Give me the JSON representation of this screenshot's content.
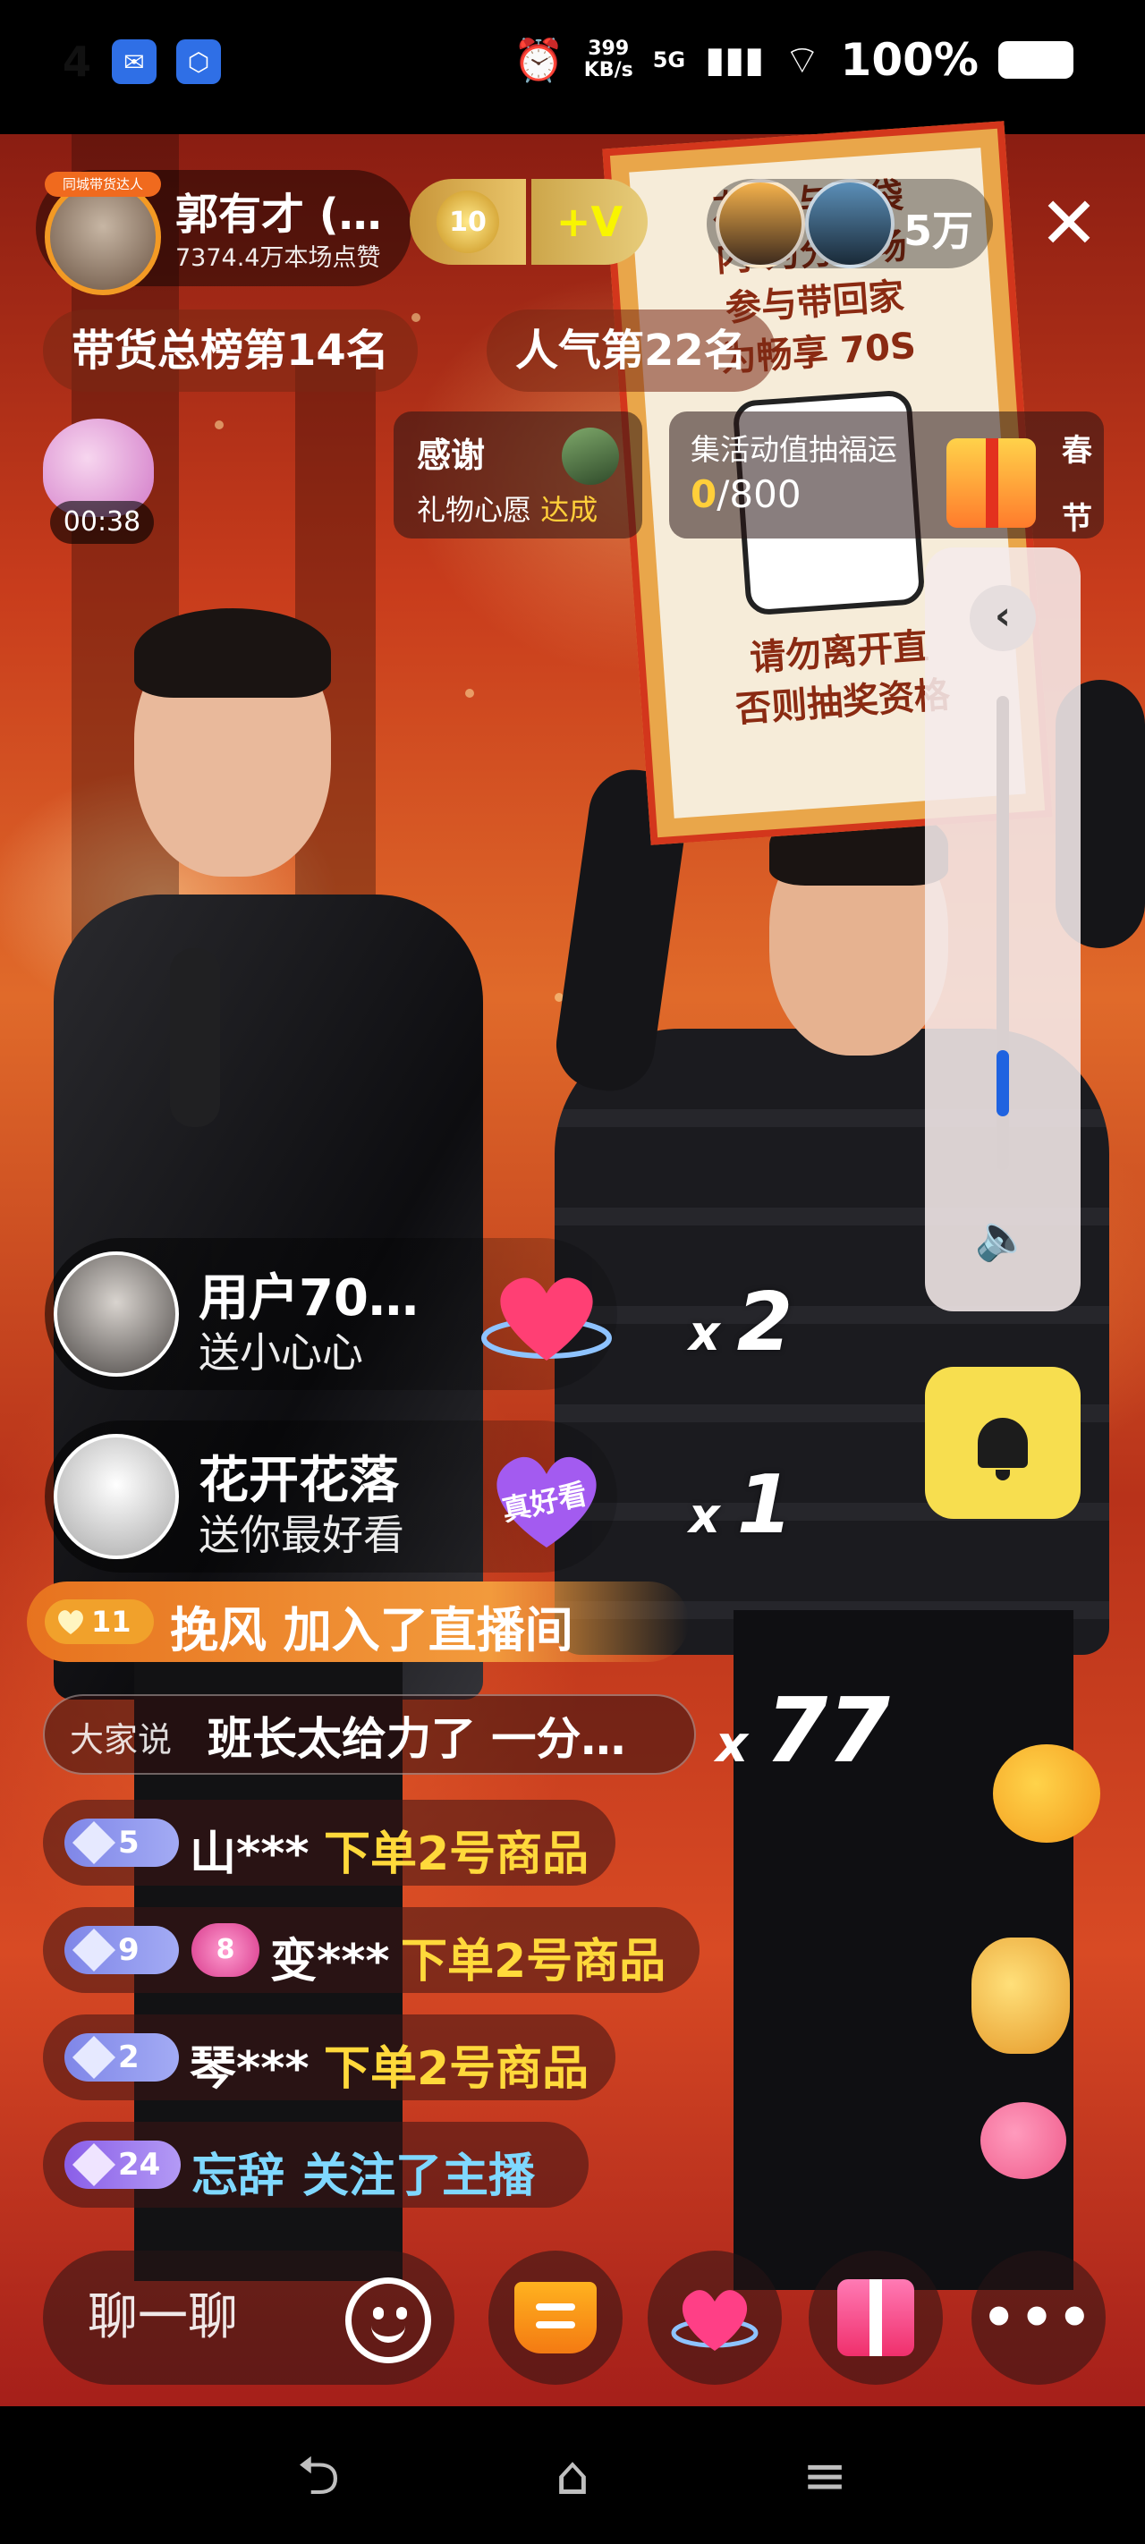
{
  "status_bar": {
    "time": "4",
    "net_speed_value": "399",
    "net_speed_unit": "KB/s",
    "signal": "5G",
    "battery": "100%"
  },
  "host": {
    "avatar_tag": "同城带货达人",
    "name": "郭有才 (…",
    "likes": "7374.4万本场点赞",
    "fan_level": "10",
    "vip_label": "+V"
  },
  "viewers": {
    "count": "5万"
  },
  "rank": {
    "sales": "带货总榜第14名",
    "popularity": "人气第22名"
  },
  "gift_bag": {
    "timer": "00:38"
  },
  "thanks_card": {
    "title": "感谢",
    "subtitle": "礼物心愿",
    "status": "达成"
  },
  "collect_card": {
    "title": "集活动值抽福运",
    "current": "0",
    "total": "/800",
    "festival_line1": "春",
    "festival_line2": "节"
  },
  "sign_board": {
    "line1": "左 参与福袋",
    "line2": "内 为分会场",
    "line3": "参与带回家",
    "line4": "为畅享 70S",
    "line5": "请勿离开直",
    "line6": "否则抽奖资格"
  },
  "volume": {
    "level": 0.14
  },
  "gift_messages": [
    {
      "name": "用户70…",
      "action": "送小心心",
      "count": "2"
    },
    {
      "name": "花开花落",
      "action": "送你最好看",
      "gift_label": "真好看",
      "count": "1"
    }
  ],
  "join_message": {
    "level": "11",
    "text": "挽风 加入了直播间"
  },
  "combo_message": {
    "tag": "大家说",
    "text": "班长太给力了 一分…",
    "count": "77"
  },
  "order_messages": [
    {
      "level": "5",
      "user": "山***",
      "text": "下单2号商品"
    },
    {
      "level": "9",
      "fan_level": "8",
      "user": "变***",
      "text": "下单2号商品"
    },
    {
      "level": "2",
      "user": "琴***",
      "text": "下单2号商品"
    }
  ],
  "follow_message": {
    "level": "24",
    "user": "忘辞",
    "text": "关注了主播"
  },
  "bottom_bar": {
    "chat_placeholder": "聊一聊"
  },
  "colors": {
    "accent_yellow": "#ffd93b",
    "follow_cyan": "#7fd8ff",
    "volume_blue": "#1f63e0",
    "bell_yellow": "#f7de4f"
  }
}
